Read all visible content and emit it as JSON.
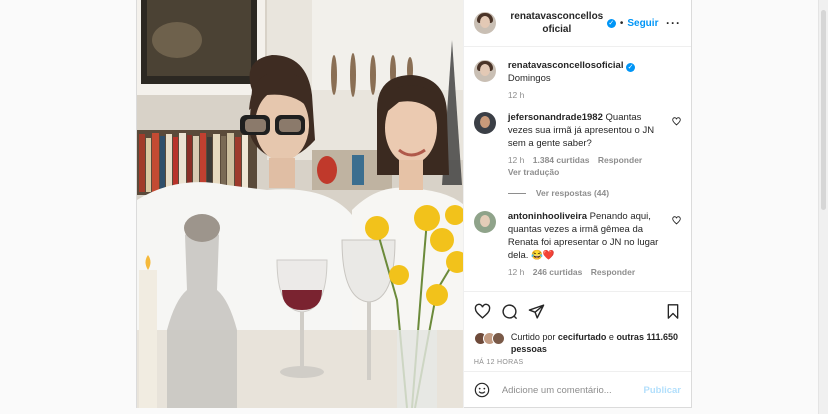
{
  "post": {
    "author": "renatavasconcellosoficial",
    "author_line1": "renatavasconcellos",
    "author_line2": "oficial",
    "follow_label": "Seguir",
    "dot": "•",
    "more_label": "···",
    "verified_mark": "✓",
    "caption": "Domingos",
    "caption_time": "12 h",
    "photo_alt": "Duas mulheres sentadas à mesa com flores amarelas e taças"
  },
  "comments": [
    {
      "user": "jefersonandrade1982",
      "text": "Quantas vezes sua irmã já apresentou o JN sem a gente saber?",
      "time": "12 h",
      "likes": "1.384 curtidas",
      "reply": "Responder",
      "translate": "Ver tradução",
      "replies": "Ver respostas (44)"
    },
    {
      "user": "antoninhooliveira",
      "text": "Penando aqui, quantas vezes a irmã gêmea da Renata foi apresentar o JN no lugar dela. 😂❤️",
      "time": "12 h",
      "likes": "246 curtidas",
      "reply": "Responder"
    }
  ],
  "likes": {
    "prefix": "Curtido por",
    "user": "cecifurtado",
    "middle": "e",
    "others": "outras 111.650 pessoas"
  },
  "time_ago": "HÁ 12 HORAS",
  "add_comment": {
    "placeholder": "Adicione um comentário...",
    "publish": "Publicar"
  },
  "icons": {
    "heart": "heart-icon",
    "comment": "comment-icon",
    "share": "share-icon",
    "save": "bookmark-icon",
    "emoji": "emoji-icon"
  },
  "colors": {
    "accent": "#0095f6",
    "muted": "#8e8e8e",
    "publish_disabled": "#b2dffc"
  }
}
